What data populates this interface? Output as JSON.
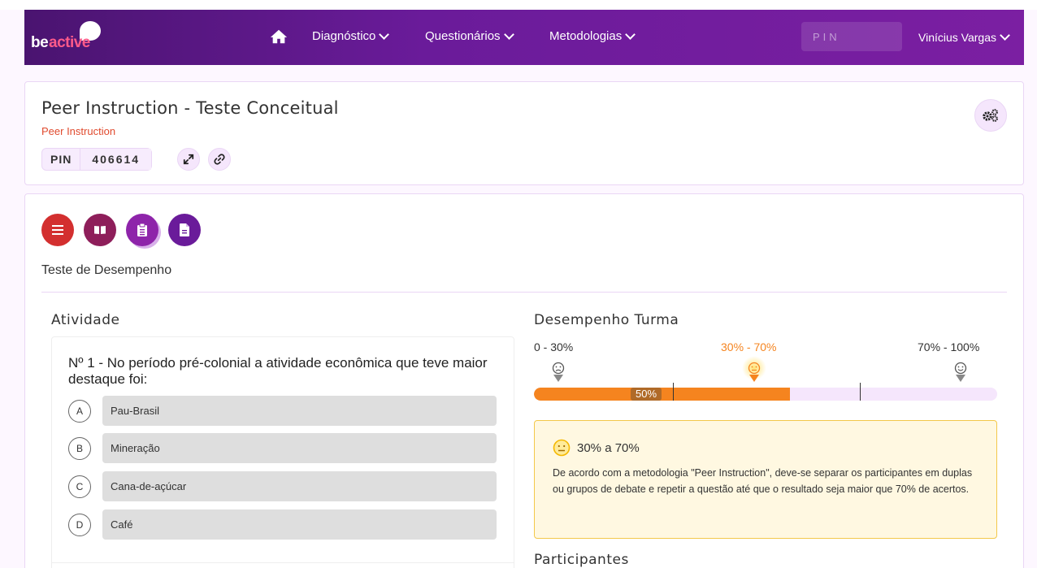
{
  "navbar": {
    "logo_be": "be",
    "logo_active": "active",
    "menu": [
      {
        "label": "Diagnóstico"
      },
      {
        "label": "Questionários"
      },
      {
        "label": "Metodologias"
      }
    ],
    "pin_placeholder": "PIN",
    "user_name": "Vinícius Vargas",
    "bg_color": "#6a1b9a"
  },
  "header": {
    "title": "Peer Instruction - Teste Conceitual",
    "subtitle": "Peer Instruction",
    "pin_label": "PIN",
    "pin_value": "406614",
    "icons": [
      "expand-icon",
      "link-icon",
      "cogs-icon"
    ]
  },
  "main": {
    "action_buttons": [
      {
        "name": "menu-icon",
        "color": "#d32f2f"
      },
      {
        "name": "book-icon",
        "color": "#8e1e5a"
      },
      {
        "name": "clipboard-icon",
        "color": "#8e24aa"
      },
      {
        "name": "file-icon",
        "color": "#6a1b9a"
      }
    ],
    "section_label": "Teste de Desempenho",
    "activity": {
      "title": "Atividade",
      "question": "Nº 1 - No período pré-colonial a atividade econômica que teve maior destaque foi:",
      "options": [
        {
          "letter": "A",
          "text": "Pau-Brasil"
        },
        {
          "letter": "B",
          "text": "Mineração"
        },
        {
          "letter": "C",
          "text": "Cana-de-açúcar"
        },
        {
          "letter": "D",
          "text": "Café"
        }
      ]
    },
    "performance": {
      "title": "Desempenho Turma",
      "ranges": [
        "0 - 30%",
        "30% - 70%",
        "70% - 100%"
      ],
      "active_range": 1,
      "percent": 0.5,
      "percent_label": "50%",
      "accent_color": "#f5841f",
      "info_title": "30% a 70%",
      "info_text": "De acordo com a metodologia \"Peer Instruction\", deve-se separar os participantes em duplas ou grupos de debate e repetir a questão até que o resultado seja maior que 70% de acertos."
    },
    "participants_title": "Participantes"
  }
}
